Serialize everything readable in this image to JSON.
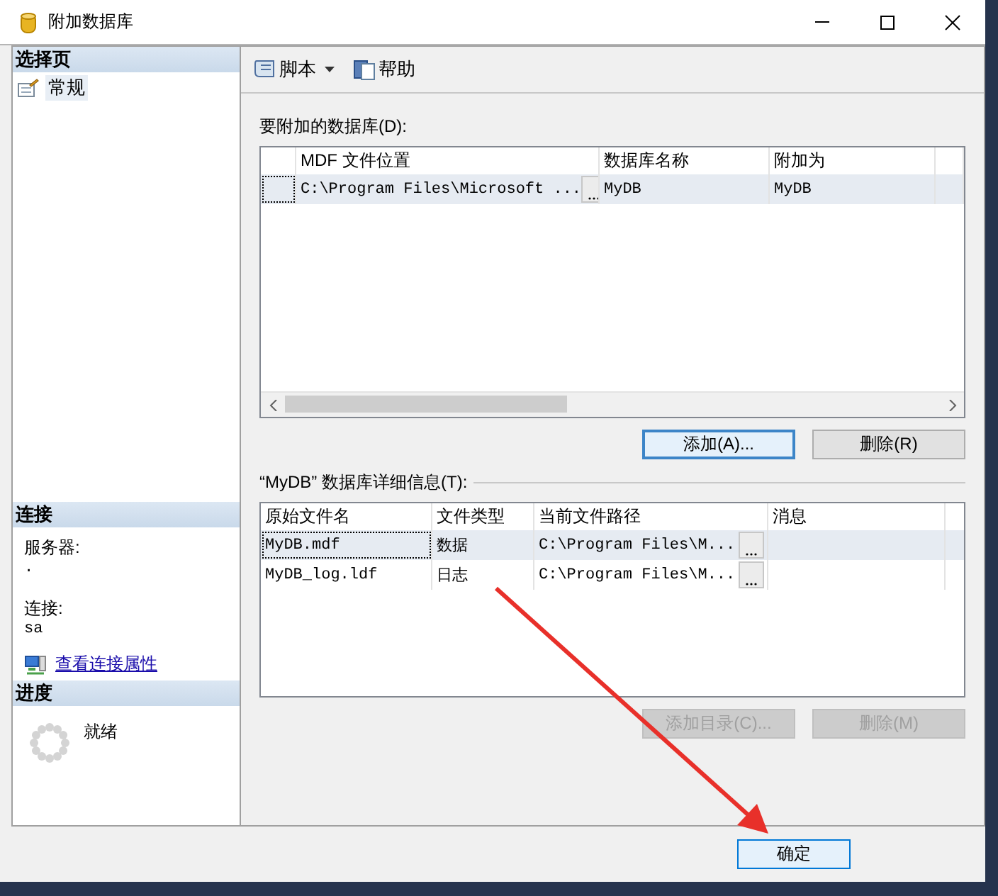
{
  "window": {
    "title": "附加数据库"
  },
  "sidebar": {
    "header": "选择页",
    "pages": [
      {
        "label": "常规",
        "selected": true
      }
    ]
  },
  "connection": {
    "header": "连接",
    "server_label": "服务器:",
    "server": ".",
    "connection_label": "连接:",
    "connection": "sa",
    "link": "查看连接属性"
  },
  "progress": {
    "header": "进度",
    "status": "就绪"
  },
  "toolbar": {
    "items": [
      {
        "label": "脚本",
        "kind": "dropdown"
      },
      {
        "label": "帮助",
        "kind": "button"
      }
    ]
  },
  "databases": {
    "label": "要附加的数据库(D):",
    "columns": [
      "MDF 文件位置",
      "数据库名称",
      "附加为"
    ],
    "rows": [
      {
        "cells": [
          "C:\\Program Files\\Microsoft ...",
          "MyDB",
          "MyDB"
        ],
        "selected": true
      }
    ],
    "buttons": [
      {
        "label": "添加(A)...",
        "disabled": false,
        "focused": true
      },
      {
        "label": "删除(R)",
        "disabled": false,
        "focused": false
      }
    ]
  },
  "details": {
    "label": "“MyDB” 数据库详细信息(T):",
    "columns": [
      "原始文件名",
      "文件类型",
      "当前文件路径",
      "消息"
    ],
    "rows": [
      {
        "cells": [
          "MyDB.mdf",
          "数据",
          "C:\\Program Files\\M..."
        ],
        "selected": true
      },
      {
        "cells": [
          "MyDB_log.ldf",
          "日志",
          "C:\\Program Files\\M..."
        ],
        "selected": false
      }
    ],
    "buttons": [
      {
        "label": "添加目录(C)...",
        "disabled": true,
        "focused": false
      },
      {
        "label": "删除(M)",
        "disabled": true,
        "focused": false
      }
    ]
  },
  "footer": {
    "buttons": [
      {
        "label": "确定",
        "disabled": false,
        "focused": true
      }
    ]
  }
}
